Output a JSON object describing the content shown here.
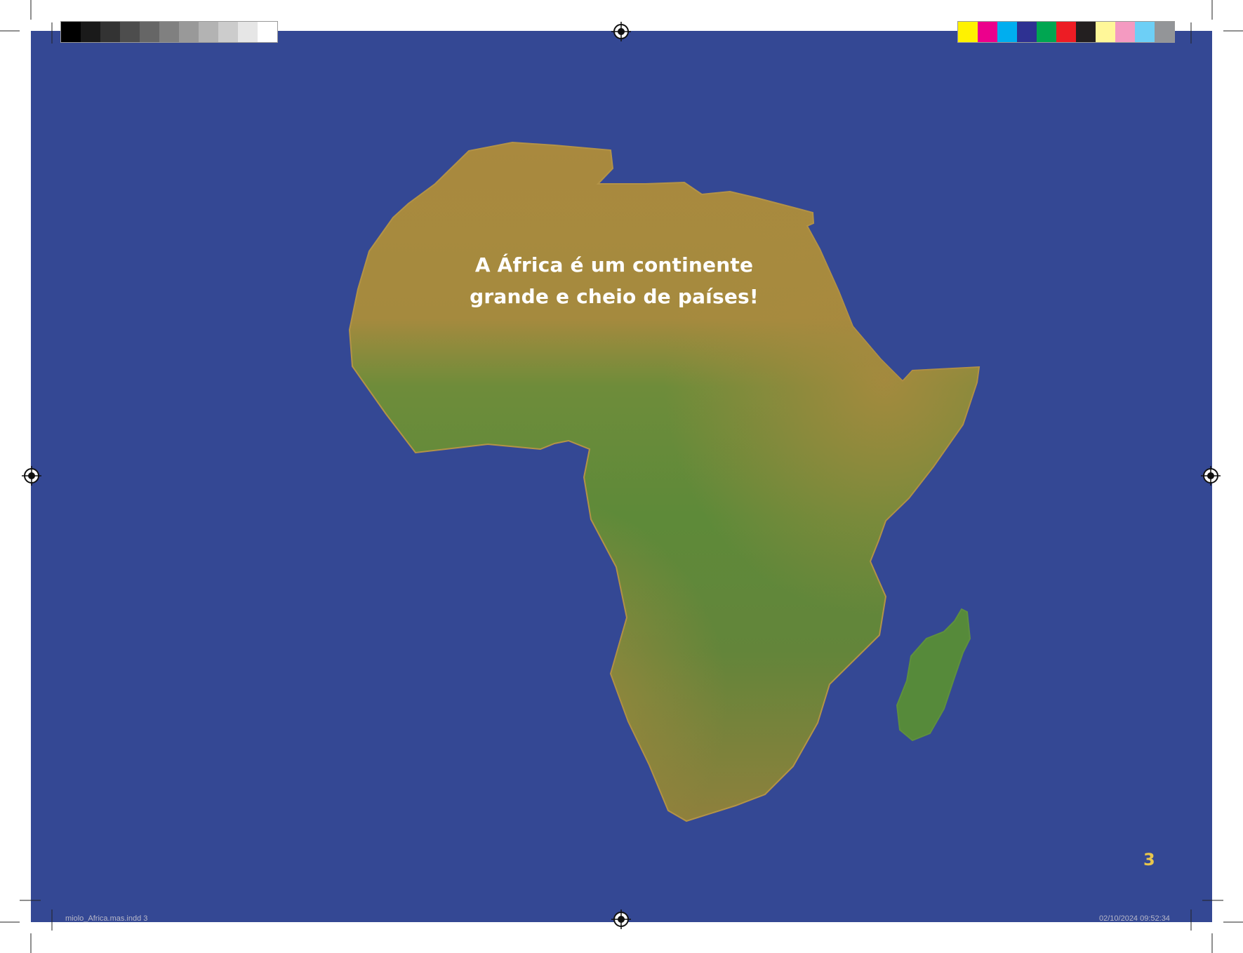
{
  "document": {
    "headline_line1": "A África é um continente",
    "headline_line2": "grande e cheio de países!",
    "page_number": "3",
    "slug_left": "miolo_Africa.mas.indd   3",
    "slug_right": "02/10/2024   09:52:34"
  },
  "colors": {
    "ocean": "#344894",
    "land_desert": "#a9893e",
    "land_green": "#5e8a39",
    "text": "#ffffff",
    "page_number": "#e8c64c"
  },
  "print_marks": {
    "gray_swatches": [
      "#000000",
      "#1a1a1a",
      "#333333",
      "#4d4d4d",
      "#666666",
      "#808080",
      "#999999",
      "#b3b3b3",
      "#cccccc",
      "#e6e6e6",
      "#ffffff"
    ],
    "color_swatches": [
      "#fff200",
      "#ec008c",
      "#00aeef",
      "#2e3192",
      "#00a651",
      "#ed1c24",
      "#231f20",
      "#fff799",
      "#f49ac1",
      "#6dcff6",
      "#939598"
    ]
  }
}
